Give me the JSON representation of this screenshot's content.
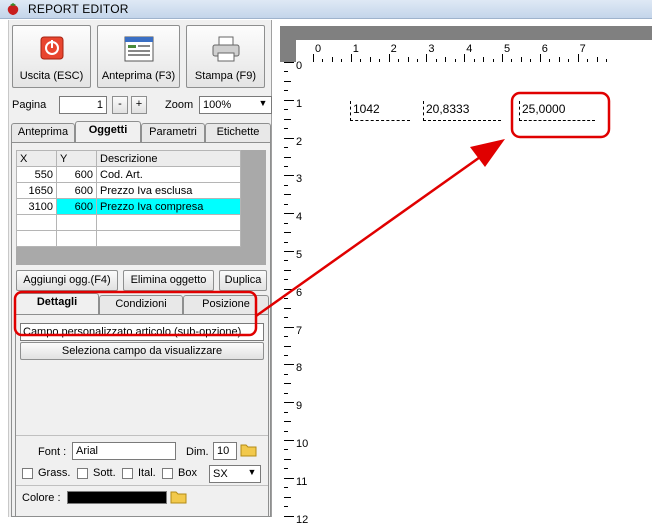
{
  "window": {
    "title": "REPORT EDITOR"
  },
  "toolbar": {
    "exit_label": "Uscita (ESC)",
    "preview_label": "Anteprima (F3)",
    "print_label": "Stampa (F9)"
  },
  "page": {
    "label": "Pagina",
    "value": "1",
    "minus": "-",
    "plus": "+"
  },
  "zoom": {
    "label": "Zoom",
    "value": "100%"
  },
  "main_tabs": [
    "Anteprima",
    "Oggetti",
    "Parametri",
    "Etichette"
  ],
  "objects_table": {
    "columns": [
      "X",
      "Y",
      "Descrizione"
    ],
    "rows": [
      {
        "x": "550",
        "y": "600",
        "desc": "Cod. Art."
      },
      {
        "x": "1650",
        "y": "600",
        "desc": "Prezzo Iva esclusa"
      },
      {
        "x": "3100",
        "y": "600",
        "desc": "Prezzo Iva compresa"
      }
    ]
  },
  "object_buttons": {
    "add": "Aggiungi ogg.(F4)",
    "delete": "Elimina oggetto",
    "duplicate": "Duplica"
  },
  "sub_tabs": [
    "Dettagli",
    "Condizioni",
    "Posizione"
  ],
  "details": {
    "field_label": "Campo personalizzato articolo (sub-opzione)",
    "select_button": "Seleziona campo da visualizzare"
  },
  "font": {
    "label": "Font :",
    "value": "Arial",
    "dim_label": "Dim.",
    "dim_value": "10",
    "bold": "Grass.",
    "underline": "Sott.",
    "italic": "Ital.",
    "box": "Box",
    "align_value": "SX"
  },
  "color": {
    "label": "Colore :",
    "value": "#000000"
  },
  "canvas": {
    "h_ruler": [
      "0",
      "1",
      "2",
      "3",
      "4",
      "5",
      "6",
      "7"
    ],
    "v_ruler": [
      "0",
      "1",
      "2",
      "3",
      "4",
      "5",
      "6",
      "7",
      "8",
      "9",
      "10",
      "11",
      "12"
    ],
    "fields": [
      "1042",
      "20,8333",
      "25,0000"
    ]
  },
  "colors": {
    "highlight_row": "#00ffff",
    "annotation": "#e00000"
  }
}
